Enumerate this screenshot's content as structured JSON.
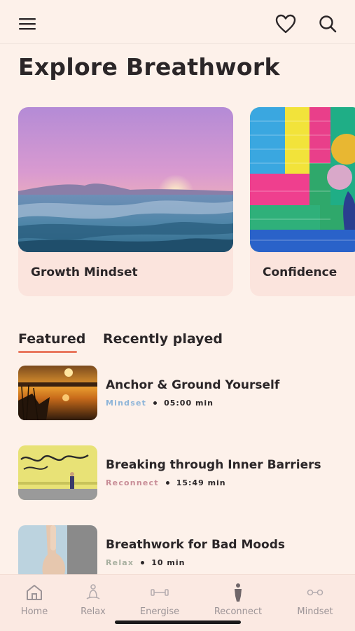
{
  "header": {
    "menu_icon": "menu-icon",
    "favorites_icon": "heart-icon",
    "search_icon": "search-icon"
  },
  "page": {
    "title": "Explore Breathwork"
  },
  "carousel": [
    {
      "label": "Growth Mindset",
      "image": "ocean-sunset"
    },
    {
      "label": "Confidence",
      "image": "colorful-brick-wall-balloons"
    }
  ],
  "tabs": {
    "featured": "Featured",
    "recent": "Recently played",
    "active": "featured"
  },
  "featured": [
    {
      "title": "Anchor & Ground Yourself",
      "category": "Mindset",
      "category_color": "#8eb5d9",
      "duration": "05:00 min",
      "image": "sunset-lake"
    },
    {
      "title": "Breaking through Inner Barriers",
      "category": "Reconnect",
      "category_color": "#c88d97",
      "duration": "15:49 min",
      "image": "believe-in-yourself-wall"
    },
    {
      "title": "Breathwork for Bad Moods",
      "category": "Relax",
      "category_color": "#a8b0a0",
      "duration": "10 min",
      "image": "thumbs-down-hand"
    }
  ],
  "bottom_nav": [
    {
      "label": "Home",
      "icon": "home-icon",
      "active": false
    },
    {
      "label": "Relax",
      "icon": "meditation-icon",
      "active": false
    },
    {
      "label": "Energise",
      "icon": "dumbbell-icon",
      "active": false
    },
    {
      "label": "Reconnect",
      "icon": "person-icon",
      "active": false
    },
    {
      "label": "Mindset",
      "icon": "mindset-icon",
      "active": true
    }
  ],
  "colors": {
    "background": "#fdf1ea",
    "card": "#fbe4dd",
    "accent": "#e9785f",
    "active_nav": "#e35a55"
  }
}
